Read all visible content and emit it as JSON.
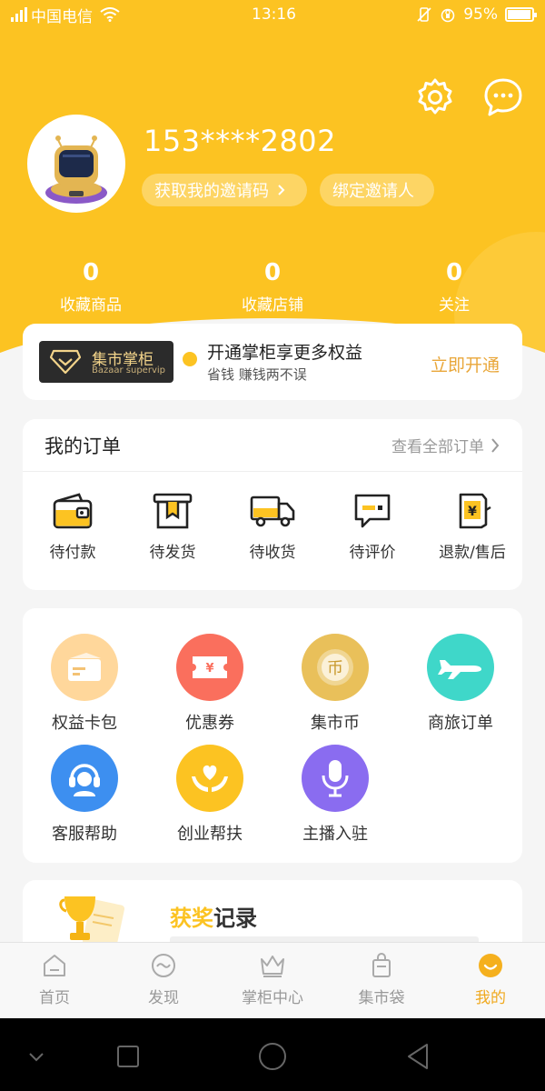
{
  "status_bar": {
    "carrier": "中国电信",
    "time": "13:16",
    "battery": "95%"
  },
  "profile": {
    "phone": "153****2802",
    "invite_code_label": "获取我的邀请码",
    "bind_inviter_label": "绑定邀请人"
  },
  "stats": [
    {
      "value": "0",
      "label": "收藏商品"
    },
    {
      "value": "0",
      "label": "收藏店铺"
    },
    {
      "value": "0",
      "label": "关注"
    }
  ],
  "vip": {
    "badge_name": "集市掌柜",
    "badge_sub": "Bazaar supervip",
    "title": "开通掌柜享更多权益",
    "subtitle": "省钱 赚钱两不误",
    "cta": "立即开通"
  },
  "orders": {
    "title": "我的订单",
    "view_all": "查看全部订单",
    "items": [
      {
        "label": "待付款",
        "icon": "wallet-icon"
      },
      {
        "label": "待发货",
        "icon": "package-icon"
      },
      {
        "label": "待收货",
        "icon": "truck-icon"
      },
      {
        "label": "待评价",
        "icon": "comment-icon"
      },
      {
        "label": "退款/售后",
        "icon": "refund-icon"
      }
    ]
  },
  "services": [
    {
      "label": "权益卡包",
      "icon": "card-wallet-icon",
      "color": "#ffd79b"
    },
    {
      "label": "优惠券",
      "icon": "coupon-icon",
      "color": "#fa6f5d"
    },
    {
      "label": "集市币",
      "icon": "coin-icon",
      "color": "#e9c05a"
    },
    {
      "label": "商旅订单",
      "icon": "airplane-icon",
      "color": "#3fd7c9"
    },
    {
      "label": "客服帮助",
      "icon": "headset-icon",
      "color": "#3d8ff0"
    },
    {
      "label": "创业帮扶",
      "icon": "heart-hands-icon",
      "color": "#fcc322"
    },
    {
      "label": "主播入驻",
      "icon": "microphone-icon",
      "color": "#8a6cf0"
    }
  ],
  "award": {
    "title_highlight": "获奖",
    "title_rest": "记录"
  },
  "tabbar": [
    {
      "label": "首页",
      "icon": "home-icon",
      "active": false
    },
    {
      "label": "发现",
      "icon": "discover-icon",
      "active": false
    },
    {
      "label": "掌柜中心",
      "icon": "crown-icon",
      "active": false
    },
    {
      "label": "集市袋",
      "icon": "bag-icon",
      "active": false
    },
    {
      "label": "我的",
      "icon": "profile-icon",
      "active": true
    }
  ],
  "colors": {
    "brand_yellow": "#fcc322",
    "accent_orange": "#f0a91f"
  }
}
